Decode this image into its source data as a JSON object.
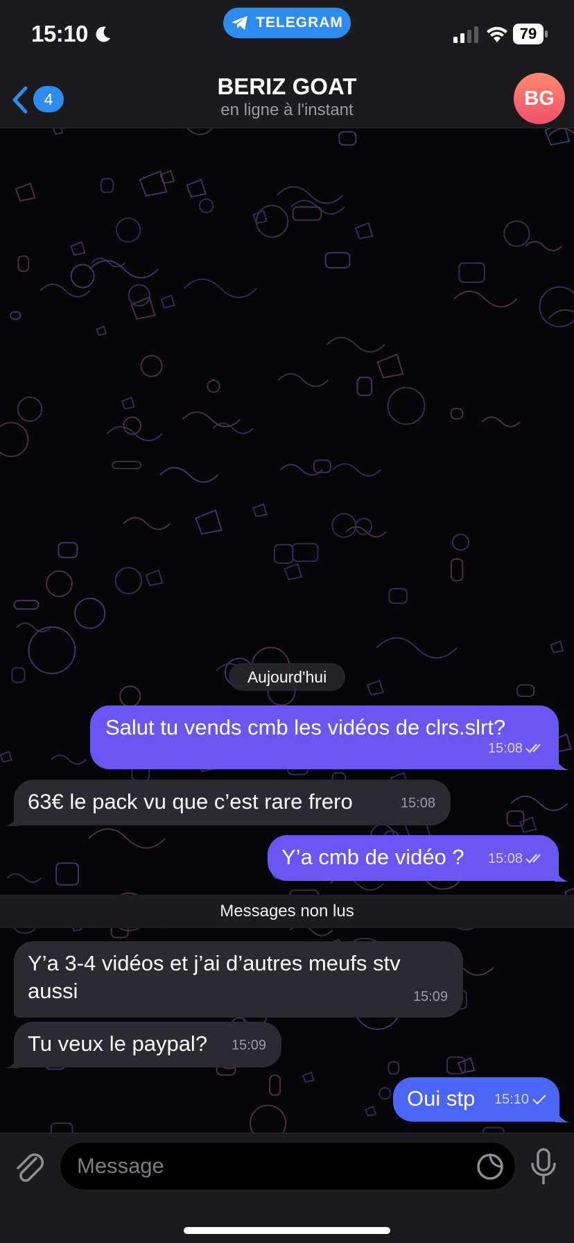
{
  "status_bar": {
    "time": "15:10",
    "app_pill": "TELEGRAM",
    "battery": "79"
  },
  "header": {
    "back_badge": "4",
    "title": "BERIZ GOAT",
    "subtitle": "en ligne à l'instant",
    "avatar_initials": "BG"
  },
  "date_separator": "Aujourd'hui",
  "unread_separator": "Messages non lus",
  "messages": [
    {
      "direction": "out",
      "text": "Salut tu vends cmb les vidéos de clrs.slrt?",
      "time": "15:08",
      "status": "read"
    },
    {
      "direction": "in",
      "text": "63€ le pack vu que c’est rare frero",
      "time": "15:08"
    },
    {
      "direction": "out",
      "text": "Y’a cmb de vidéo ?",
      "time": "15:08",
      "status": "read"
    },
    {
      "direction": "in",
      "text": "Y’a 3-4 vidéos et j’ai d’autres meufs stv aussi",
      "time": "15:09"
    },
    {
      "direction": "in",
      "text": "Tu veux le paypal?",
      "time": "15:09"
    },
    {
      "direction": "out",
      "text": "Oui stp",
      "time": "15:10",
      "status": "sent"
    }
  ],
  "composer": {
    "placeholder": "Message"
  },
  "colors": {
    "outgoing_bubble": "#6a56f4",
    "outgoing_bubble_latest": "#4b65f6",
    "incoming_bubble": "#2b2a30",
    "accent": "#2d8cf0",
    "background": "#050507"
  }
}
